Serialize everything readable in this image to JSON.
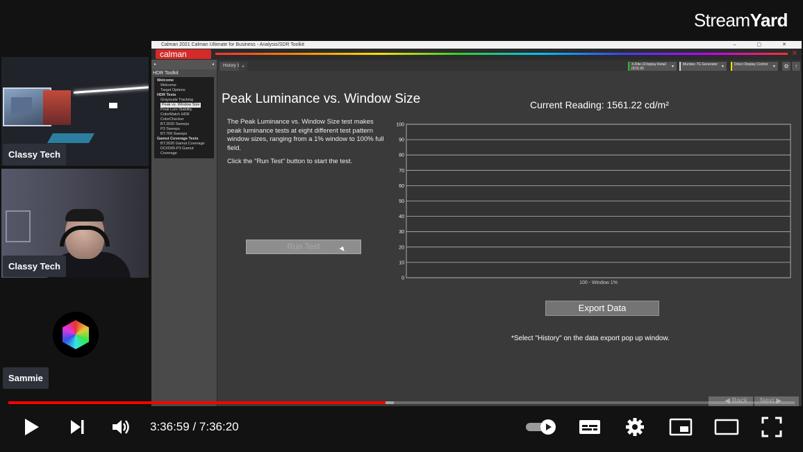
{
  "brand": {
    "part1": "Stream",
    "part2": "Yard"
  },
  "participants": [
    {
      "name": "Classy Tech"
    },
    {
      "name": "Classy Tech"
    },
    {
      "name": "Sammie"
    }
  ],
  "calman": {
    "window_title": "Calman 2021 Calman Ultimate for Business - Analysis/SDR Toolkit",
    "window_controls": "– ▢ ✕",
    "logo_text": "calman",
    "side_panel": {
      "title": "HDR Toolkit",
      "tree": [
        {
          "label": "Welcome",
          "type": "grp"
        },
        {
          "label": "Welcome",
          "type": "itm"
        },
        {
          "label": "Target Options",
          "type": "itm"
        },
        {
          "label": "HDR Tests",
          "type": "grp"
        },
        {
          "label": "Grayscale Tracking",
          "type": "itm"
        },
        {
          "label": "Peak vs. Window Size",
          "type": "sel"
        },
        {
          "label": "Peak Lum Stability",
          "type": "itm"
        },
        {
          "label": "ColorMatch HDR",
          "type": "itm"
        },
        {
          "label": "ColorChecker",
          "type": "itm"
        },
        {
          "label": "BT.2020 Sweeps",
          "type": "itm"
        },
        {
          "label": "P3 Sweeps",
          "type": "itm"
        },
        {
          "label": "BT.709 Sweeps",
          "type": "itm"
        },
        {
          "label": "Gamut Coverage Tests",
          "type": "grp"
        },
        {
          "label": "BT.2020 Gamut Coverage",
          "type": "itm"
        },
        {
          "label": "DCI/D65-P3 Gamut Coverage",
          "type": "itm"
        }
      ]
    },
    "tab": {
      "label": "History 1",
      "add": "+"
    },
    "devices": [
      {
        "line1": "X-Rite i1Display Retail",
        "line2": "(ID3) 65"
      },
      {
        "line1": "Murideo 7G Generator",
        "line2": ""
      },
      {
        "line1": "Direct Display Control",
        "line2": ""
      }
    ],
    "page_title": "Peak Luminance vs. Window Size",
    "intro_p1": "The Peak Luminance vs. Window Size test makes peak luminance tests at eight different test pattern window sizes, ranging from a 1% window to 100% full field.",
    "intro_p2": "Click the \"Run Test\" button to start the test.",
    "run_button": "Run Test",
    "current_reading": "Current Reading: 1561.22 cd/m²",
    "export_button": "Export  Data",
    "export_note": "*Select \"History\" on the data export pop up window.",
    "nav_back": "◀ Back",
    "nav_next": "Next ▶"
  },
  "chart_data": {
    "type": "line",
    "y_ticks": [
      "0",
      "10",
      "20",
      "30",
      "40",
      "50",
      "60",
      "70",
      "80",
      "90",
      "100"
    ],
    "x_label": "100 - Window  1%",
    "ylim": [
      0,
      100
    ],
    "grid": true,
    "series": []
  },
  "player": {
    "time": "3:36:59 / 7:36:20",
    "played_fraction": 0.48,
    "buffered_fraction": 0.49,
    "accent": "#ff0000"
  }
}
